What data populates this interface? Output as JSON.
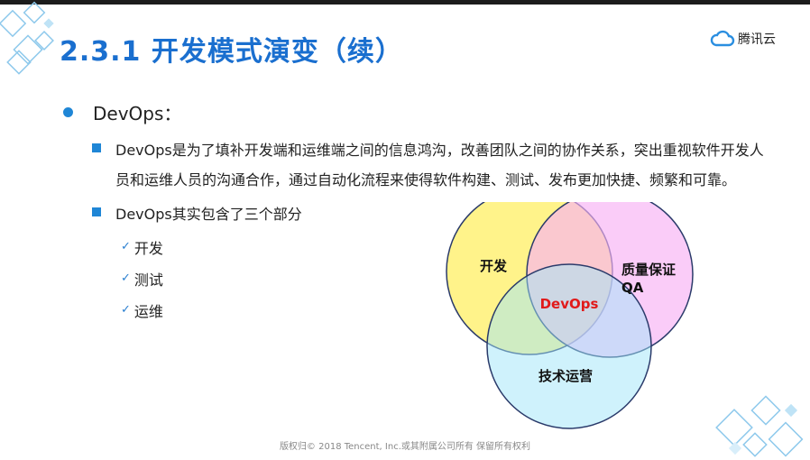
{
  "header": {
    "title": "2.3.1 开发模式演变（续）",
    "logo_text": "腾讯云"
  },
  "content": {
    "bullet1": "DevOps：",
    "sub1": "DevOps是为了填补开发端和运维端之间的信息鸿沟，改善团队之间的协作关系，突出重视软件开发人员和运维人员的沟通合作，通过自动化流程来使得软件构建、测试、发布更加快捷、频繁和可靠。",
    "sub2": "DevOps其实包含了三个部分",
    "checks": [
      "开发",
      "测试",
      "运维"
    ]
  },
  "diagram": {
    "circle_dev": "开发",
    "circle_qa_line1": "质量保证",
    "circle_qa_line2": "QA",
    "circle_ops": "技术运营",
    "center": "DevOps"
  },
  "footer": {
    "copyright": "版权归© 2018 Tencent, Inc.或其附属公司所有 保留所有权利"
  },
  "colors": {
    "title": "#1a6fcf",
    "bullet": "#1f86d6",
    "dev_circle": "#fff176",
    "qa_circle": "#f7b0f5",
    "ops_circle": "#9fe6f9",
    "center_text": "#e11a1a"
  }
}
